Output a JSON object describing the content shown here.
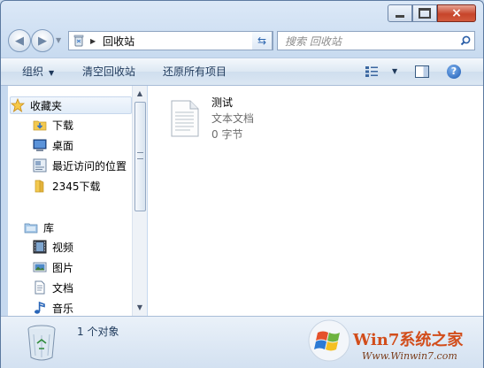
{
  "window": {
    "caption_buttons": {
      "minimize": "minimize",
      "maximize": "maximize",
      "close": "×"
    }
  },
  "address_bar": {
    "path": "回收站",
    "separator": "▶",
    "dropdown": "▼",
    "refresh": "⇆"
  },
  "search": {
    "placeholder": "搜索 回收站"
  },
  "nav_buttons": {
    "back": "◀",
    "forward": "▶",
    "history": "▼"
  },
  "toolbar": {
    "organize": "组织",
    "organize_caret": "▼",
    "empty_bin": "清空回收站",
    "restore_all": "还原所有项目",
    "views_caret": "▼",
    "help": "?"
  },
  "nav_pane": {
    "favorites": {
      "label": "收藏夹",
      "items": [
        {
          "label": "下载",
          "icon": "download-folder-icon"
        },
        {
          "label": "桌面",
          "icon": "desktop-icon"
        },
        {
          "label": "最近访问的位置",
          "icon": "recent-places-icon"
        },
        {
          "label": "2345下载",
          "icon": "folder-icon"
        }
      ]
    },
    "libraries": {
      "label": "库",
      "items": [
        {
          "label": "视频",
          "icon": "video-library-icon"
        },
        {
          "label": "图片",
          "icon": "pictures-library-icon"
        },
        {
          "label": "文档",
          "icon": "documents-library-icon"
        },
        {
          "label": "音乐",
          "icon": "music-library-icon"
        }
      ]
    }
  },
  "files": [
    {
      "name": "测试",
      "type": "文本文档",
      "size": "0 字节",
      "icon": "text-document-icon"
    }
  ],
  "details": {
    "count": "1 个对象"
  },
  "watermark": {
    "brand": "Win7系统之家",
    "url": "Www.Winwin7.com"
  },
  "colors": {
    "close_button": "#c7452b",
    "nav_text": "#1e395b",
    "watermark": "#d24d1b"
  }
}
